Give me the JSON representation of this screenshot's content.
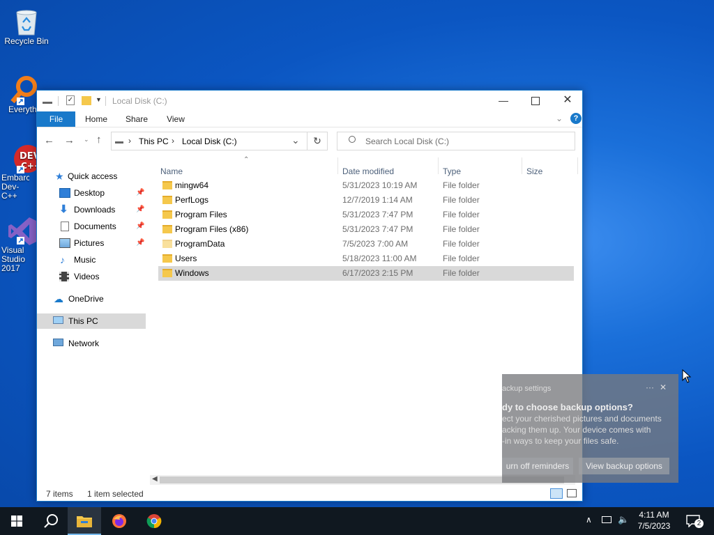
{
  "desktop": {
    "icons": [
      {
        "label": "Recycle Bin"
      },
      {
        "label": "Everything"
      },
      {
        "label": "Embarcadero Dev-C++"
      },
      {
        "label": "Visual Studio 2017"
      }
    ]
  },
  "explorer": {
    "title": "Local Disk (C:)",
    "ribbon_tabs": [
      "File",
      "Home",
      "Share",
      "View"
    ],
    "breadcrumb": [
      "This PC",
      "Local Disk (C:)"
    ],
    "search_placeholder": "Search Local Disk (C:)",
    "nav": {
      "quick_access": "Quick access",
      "quick_items": [
        "Desktop",
        "Downloads",
        "Documents",
        "Pictures",
        "Music",
        "Videos"
      ],
      "onedrive": "OneDrive",
      "this_pc": "This PC",
      "network": "Network"
    },
    "columns": [
      "Name",
      "Date modified",
      "Type",
      "Size"
    ],
    "files": [
      {
        "name": "mingw64",
        "date": "5/31/2023 10:19 AM",
        "type": "File folder"
      },
      {
        "name": "PerfLogs",
        "date": "12/7/2019 1:14 AM",
        "type": "File folder"
      },
      {
        "name": "Program Files",
        "date": "5/31/2023 7:47 PM",
        "type": "File folder"
      },
      {
        "name": "Program Files (x86)",
        "date": "5/31/2023 7:47 PM",
        "type": "File folder"
      },
      {
        "name": "ProgramData",
        "date": "7/5/2023 7:00 AM",
        "type": "File folder"
      },
      {
        "name": "Users",
        "date": "5/18/2023 11:00 AM",
        "type": "File folder"
      },
      {
        "name": "Windows",
        "date": "6/17/2023 2:15 PM",
        "type": "File folder"
      }
    ],
    "status_count": "7 items",
    "status_selected": "1 item selected"
  },
  "toast": {
    "app": "ackup settings",
    "heading": "dy to choose backup options?",
    "body_lines": [
      "ect your cherished pictures and documents",
      "acking them up. Your device comes with",
      "-in ways to keep your files safe."
    ],
    "btn_off": "urn off reminders",
    "btn_view": "View backup options"
  },
  "taskbar": {
    "time": "4:11 AM",
    "date": "7/5/2023",
    "notif_count": "2"
  }
}
